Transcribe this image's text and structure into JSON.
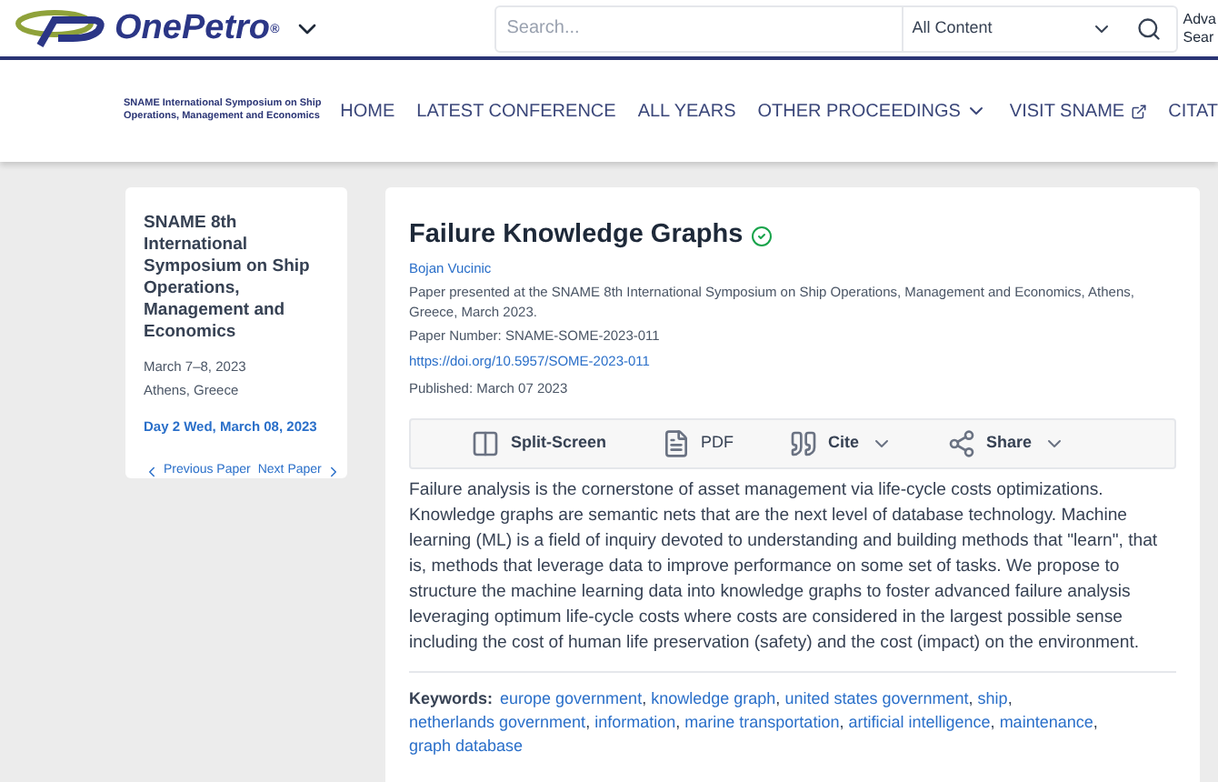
{
  "header": {
    "logo_text": "OnePetro",
    "logo_mark": "®",
    "search": {
      "placeholder": "Search..."
    },
    "scope": {
      "value": "All Content"
    },
    "advanced": [
      "Adva",
      "Sear"
    ]
  },
  "nav": {
    "brand": [
      "SNAME International Symposium on Ship",
      "Operations, Management and Economics"
    ],
    "items": [
      {
        "label": "HOME",
        "kind": "plain"
      },
      {
        "label": "LATEST CONFERENCE",
        "kind": "plain"
      },
      {
        "label": "ALL YEARS",
        "kind": "plain"
      },
      {
        "label": "OTHER PROCEEDINGS",
        "kind": "dropdown"
      },
      {
        "label": "VISIT SNAME",
        "kind": "external"
      },
      {
        "label": "CITAT",
        "kind": "plain"
      }
    ]
  },
  "sidebar": {
    "title": "SNAME 8th International Symposium on Ship Operations, Management and Economics",
    "dates": "March 7–8, 2023",
    "place": "Athens, Greece",
    "day": "Day 2 Wed, March 08, 2023",
    "previous": "Previous Paper",
    "next": "Next Paper"
  },
  "article": {
    "title": "Failure Knowledge Graphs",
    "verified": true,
    "author": "Bojan Vucinic",
    "citation": "Paper presented at the SNAME 8th International Symposium on Ship Operations, Management and Economics, Athens, Greece, March 2023.",
    "paper_number": "Paper Number: SNAME-SOME-2023-011",
    "doi": "https://doi.org/10.5957/SOME-2023-011",
    "published": "Published: March 07 2023",
    "tools": [
      {
        "label": "Split-Screen",
        "kind": "split",
        "bold": true,
        "caret": false
      },
      {
        "label": "PDF",
        "kind": "pdf",
        "bold": false,
        "caret": false
      },
      {
        "label": "Cite",
        "kind": "cite",
        "bold": true,
        "caret": true
      },
      {
        "label": "Share",
        "kind": "share",
        "bold": true,
        "caret": true
      }
    ],
    "abstract": "Failure analysis is the cornerstone of asset management via life-cycle costs optimizations. Knowledge graphs are semantic nets that are the next level of database technology. Machine learning (ML) is a field of inquiry devoted to understanding and building methods that \"learn\", that is, methods that leverage data to improve performance on some set of tasks. We propose to structure the machine learning data into knowledge graphs to foster advanced failure analysis leveraging optimum life-cycle costs where costs are considered in the largest possible sense including the cost of human life preservation (safety) and the cost (impact) on the environment.",
    "keywords_label": "Keywords:",
    "keyword_separator": ",",
    "keywords": [
      "europe government",
      "knowledge graph",
      "united states government",
      "ship",
      "netherlands government",
      "information",
      "marine transportation",
      "artificial intelligence",
      "maintenance",
      "graph database"
    ]
  }
}
